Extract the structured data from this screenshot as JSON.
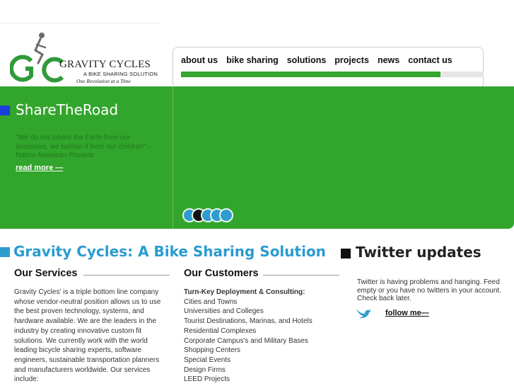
{
  "logo": {
    "title": "GRAVITY CYCLES",
    "subtitle": "A BIKE SHARING SOLUTION",
    "tagline": "One Revolution at a Time",
    "letters": "GC",
    "colors": {
      "green": "#2f9a3a",
      "gray": "#6b6b6b"
    }
  },
  "nav": {
    "items": [
      {
        "label": "about us"
      },
      {
        "label": "bike sharing"
      },
      {
        "label": "solutions"
      },
      {
        "label": "projects"
      },
      {
        "label": "news"
      },
      {
        "label": "contact us"
      }
    ],
    "accent": "#35a62f"
  },
  "hero": {
    "title": "ShareTheRoad",
    "quote": "\"We do not inherit the Earth from our ancestors, we borrow it from our children\" -Native American Proverb",
    "read_more": "read more —",
    "background": "#32a52c",
    "dots": [
      {
        "color": "#2e9cce"
      },
      {
        "color": "#111111"
      },
      {
        "color": "#2e9cce"
      },
      {
        "color": "#2e9cce"
      },
      {
        "color": "#2e9cce"
      }
    ]
  },
  "main": {
    "title": "Gravity Cycles: A Bike Sharing Solution",
    "services": {
      "heading": "Our Services",
      "text": "Gravity Cycles' is a triple bottom line company whose vendor-neutral position allows us to use the best proven technology, systems, and hardware available.  We are the leaders in the industry by creating innovative custom fit solutions. We currently work with the world leading  bicycle sharing experts, software engineers, sustainable transportation planners and manufacturers worldwide. Our services include:"
    },
    "customers": {
      "heading": "Our Customers",
      "lead": "Turn-Key Deployment & Consulting:",
      "items": [
        "Cities and Towns",
        "Universities and Colleges",
        "Tourist Destinations, Marinas, and Hotels",
        "Residential Complexes",
        "Corporate Campus's and Military Bases",
        "Shopping Centers",
        "Special Events",
        "Design Firms",
        "LEED Projects"
      ]
    }
  },
  "twitter": {
    "title": "Twitter updates",
    "message": "Twitter is having problems and hanging. Feed empty or you have no twitters in your account. Check back later.",
    "follow": "follow me—",
    "bird_icon": "twitter-bird-icon",
    "bird_color": "#2e9cce"
  }
}
